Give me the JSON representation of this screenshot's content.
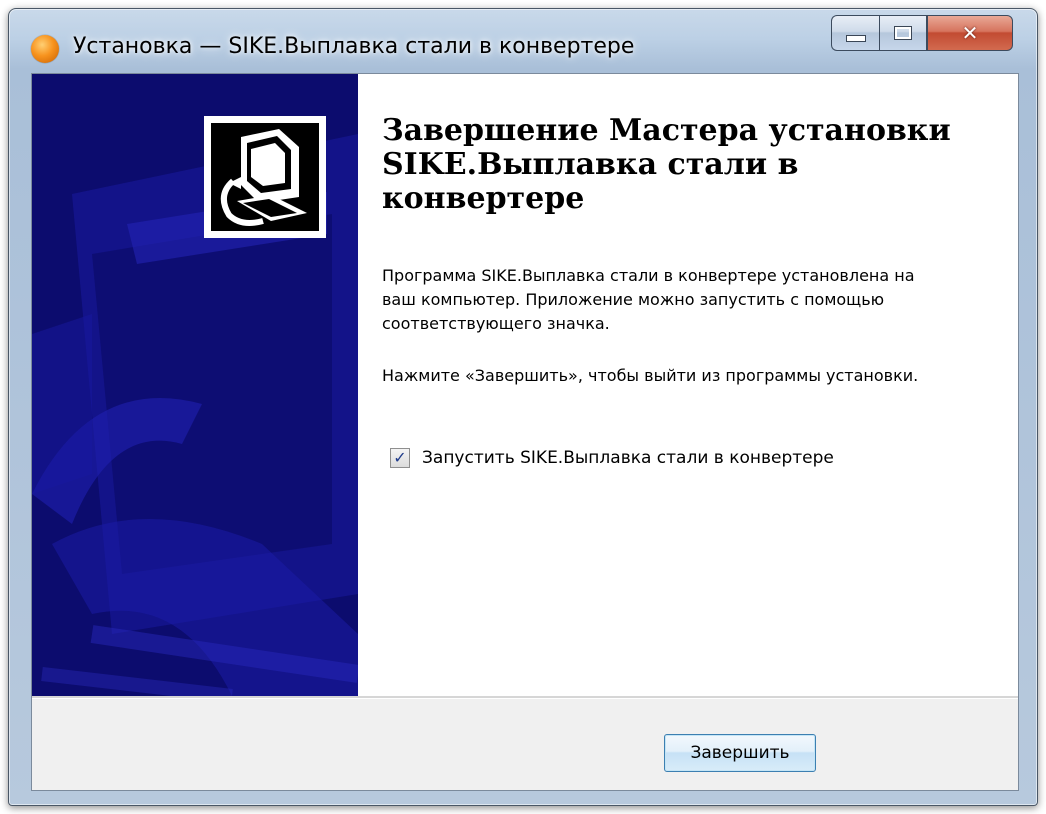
{
  "window": {
    "title": "Установка — SIKE.Выплавка стали в конвертере",
    "controls": {
      "minimize": "minimize-icon",
      "maximize": "maximize-icon",
      "close": "close-icon"
    }
  },
  "sidebar": {
    "logo_icon": "computer-install-icon"
  },
  "content": {
    "heading": "Завершение Мастера установки SIKE.Выплавка стали в конвертере",
    "paragraph1": "Программа SIKE.Выплавка стали в конвертере установлена на ваш компьютер. Приложение можно запустить с помощью соответствующего значка.",
    "paragraph2": "Нажмите «Завершить», чтобы выйти из программы установки.",
    "launch_checkbox": {
      "label": "Запустить SIKE.Выплавка стали в конвертере",
      "checked": true
    }
  },
  "footer": {
    "finish_label": "Завершить"
  },
  "colors": {
    "sidebar_bg": "#0c0c6e",
    "close_button": "#c24b32",
    "button_border": "#3c7fb1"
  }
}
